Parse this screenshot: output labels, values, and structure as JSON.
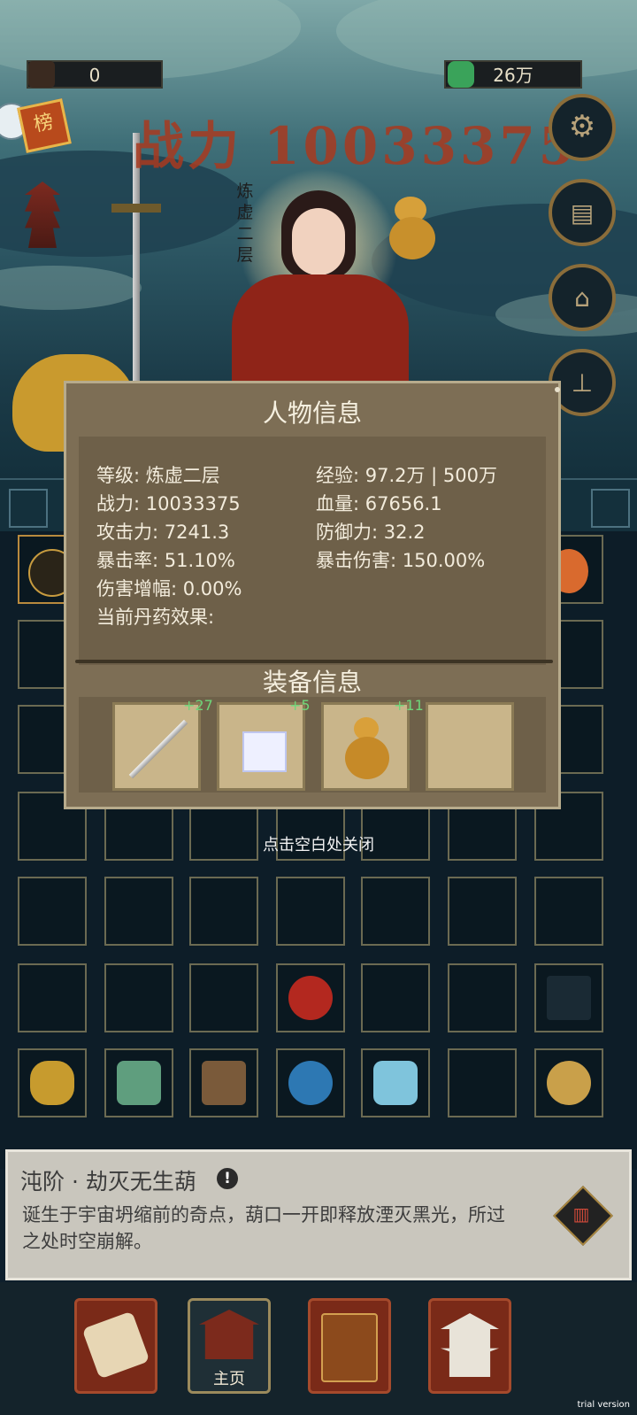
{
  "header": {
    "left_resource": {
      "icon": "scroll-icon",
      "value": "0"
    },
    "right_resource": {
      "icon": "jade-icon",
      "value": "26万"
    },
    "power_text": "战力 10033375",
    "rank_badge": "榜",
    "realm_vertical": "炼虚二层",
    "side_buttons": [
      "gear-icon",
      "notice-icon",
      "shop-icon",
      "stamp-icon"
    ]
  },
  "modal": {
    "title": "人物信息",
    "stats_left": [
      "等级: 炼虚二层",
      "战力: 10033375",
      "攻击力: 7241.3",
      "暴击率: 51.10%",
      "伤害增幅: 0.00%",
      "当前丹药效果:"
    ],
    "stats_right": [
      "经验: 97.2万 | 500万",
      "血量: 67656.1",
      "防御力: 32.2",
      "暴击伤害: 150.00%"
    ],
    "equip_title": "装备信息",
    "equipment": [
      {
        "icon": "sword-icon",
        "plus": "+27"
      },
      {
        "icon": "gift-box-icon",
        "plus": "+5"
      },
      {
        "icon": "gourd-icon",
        "plus": "+11"
      },
      {
        "icon": "empty-slot",
        "plus": ""
      }
    ]
  },
  "close_hint": "点击空白处关闭",
  "item_detail": {
    "title": "沌阶 · 劫灭无生葫",
    "description": "诞生于宇宙坍缩前的奇点，葫口一开即释放湮灭黑光，所过之处时空崩解。"
  },
  "nav": {
    "home_label": "主页",
    "items": [
      "scroll-icon",
      "home-icon",
      "book-icon",
      "pagoda-icon"
    ]
  },
  "watermark": "trial version",
  "colors": {
    "accent_power": "#a83a20",
    "modal_bg": "#7d6e55",
    "plus_green": "#6fd67a"
  }
}
